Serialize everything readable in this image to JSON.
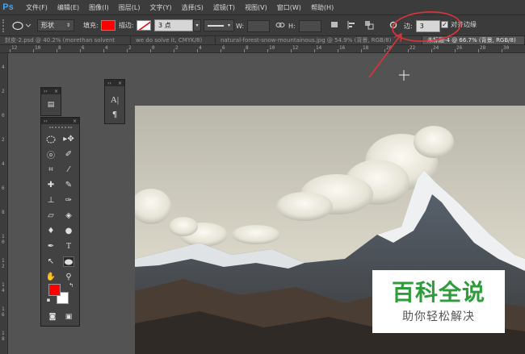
{
  "app": {
    "logo": "Ps"
  },
  "menu": [
    "文件(F)",
    "编辑(E)",
    "图像(I)",
    "图层(L)",
    "文字(Y)",
    "选择(S)",
    "滤镜(T)",
    "视图(V)",
    "窗口(W)",
    "帮助(H)"
  ],
  "options": {
    "mode_value": "形状",
    "fill_label": "填充:",
    "fill_color": "#ff0000",
    "stroke_label": "描边:",
    "stroke_size": "3 点",
    "width_label": "W:",
    "height_label": "H:",
    "sides_label": "边:",
    "sides_value": "3",
    "align_edges_label": "对齐边缘"
  },
  "tabs": [
    {
      "label": "封皮-2.psd @ 40.2% (morethan solvent",
      "active": false
    },
    {
      "label": "we do solve it, CMYK/8)",
      "active": false
    },
    {
      "label": "natural-forest-snow-mountainous.jpg @ 54.9% (背景, RGB/8)",
      "active": false
    },
    {
      "label": "未标题-4 @ 66.7% (背景, RGB/8)",
      "active": true
    }
  ],
  "ruler_top": [
    "12",
    "10",
    "8",
    "6",
    "4",
    "2",
    "0",
    "2",
    "4",
    "6",
    "8",
    "10",
    "12",
    "14",
    "16",
    "18",
    "20",
    "22",
    "24",
    "26",
    "28",
    "30",
    "32"
  ],
  "ruler_left": [
    "4",
    "2",
    "0",
    "2",
    "4",
    "6",
    "8",
    "1 0",
    "1 2",
    "1 4",
    "1 6",
    "1 8"
  ],
  "tools": {
    "icons": [
      "move-tool",
      "marquee-tool",
      "lasso-tool",
      "quick-select-tool",
      "crop-tool",
      "eyedropper-tool",
      "healing-brush-tool",
      "brush-tool",
      "clone-stamp-tool",
      "history-brush-tool",
      "eraser-tool",
      "paint-bucket-tool",
      "blur-tool",
      "dodge-tool",
      "pen-tool",
      "type-tool",
      "path-select-tool",
      "shape-tool",
      "hand-tool",
      "zoom-tool",
      "screen-mode-tool"
    ],
    "foreground_color": "#ff0000",
    "background_color": "#ffffff"
  },
  "mini_panel": {
    "icons": [
      "character-icon",
      "paragraph-icon"
    ]
  },
  "annotation_color": "#d9353a",
  "watermark": {
    "big": "百科全说",
    "small": "助你轻松解决",
    "color": "#2e9c3a"
  }
}
